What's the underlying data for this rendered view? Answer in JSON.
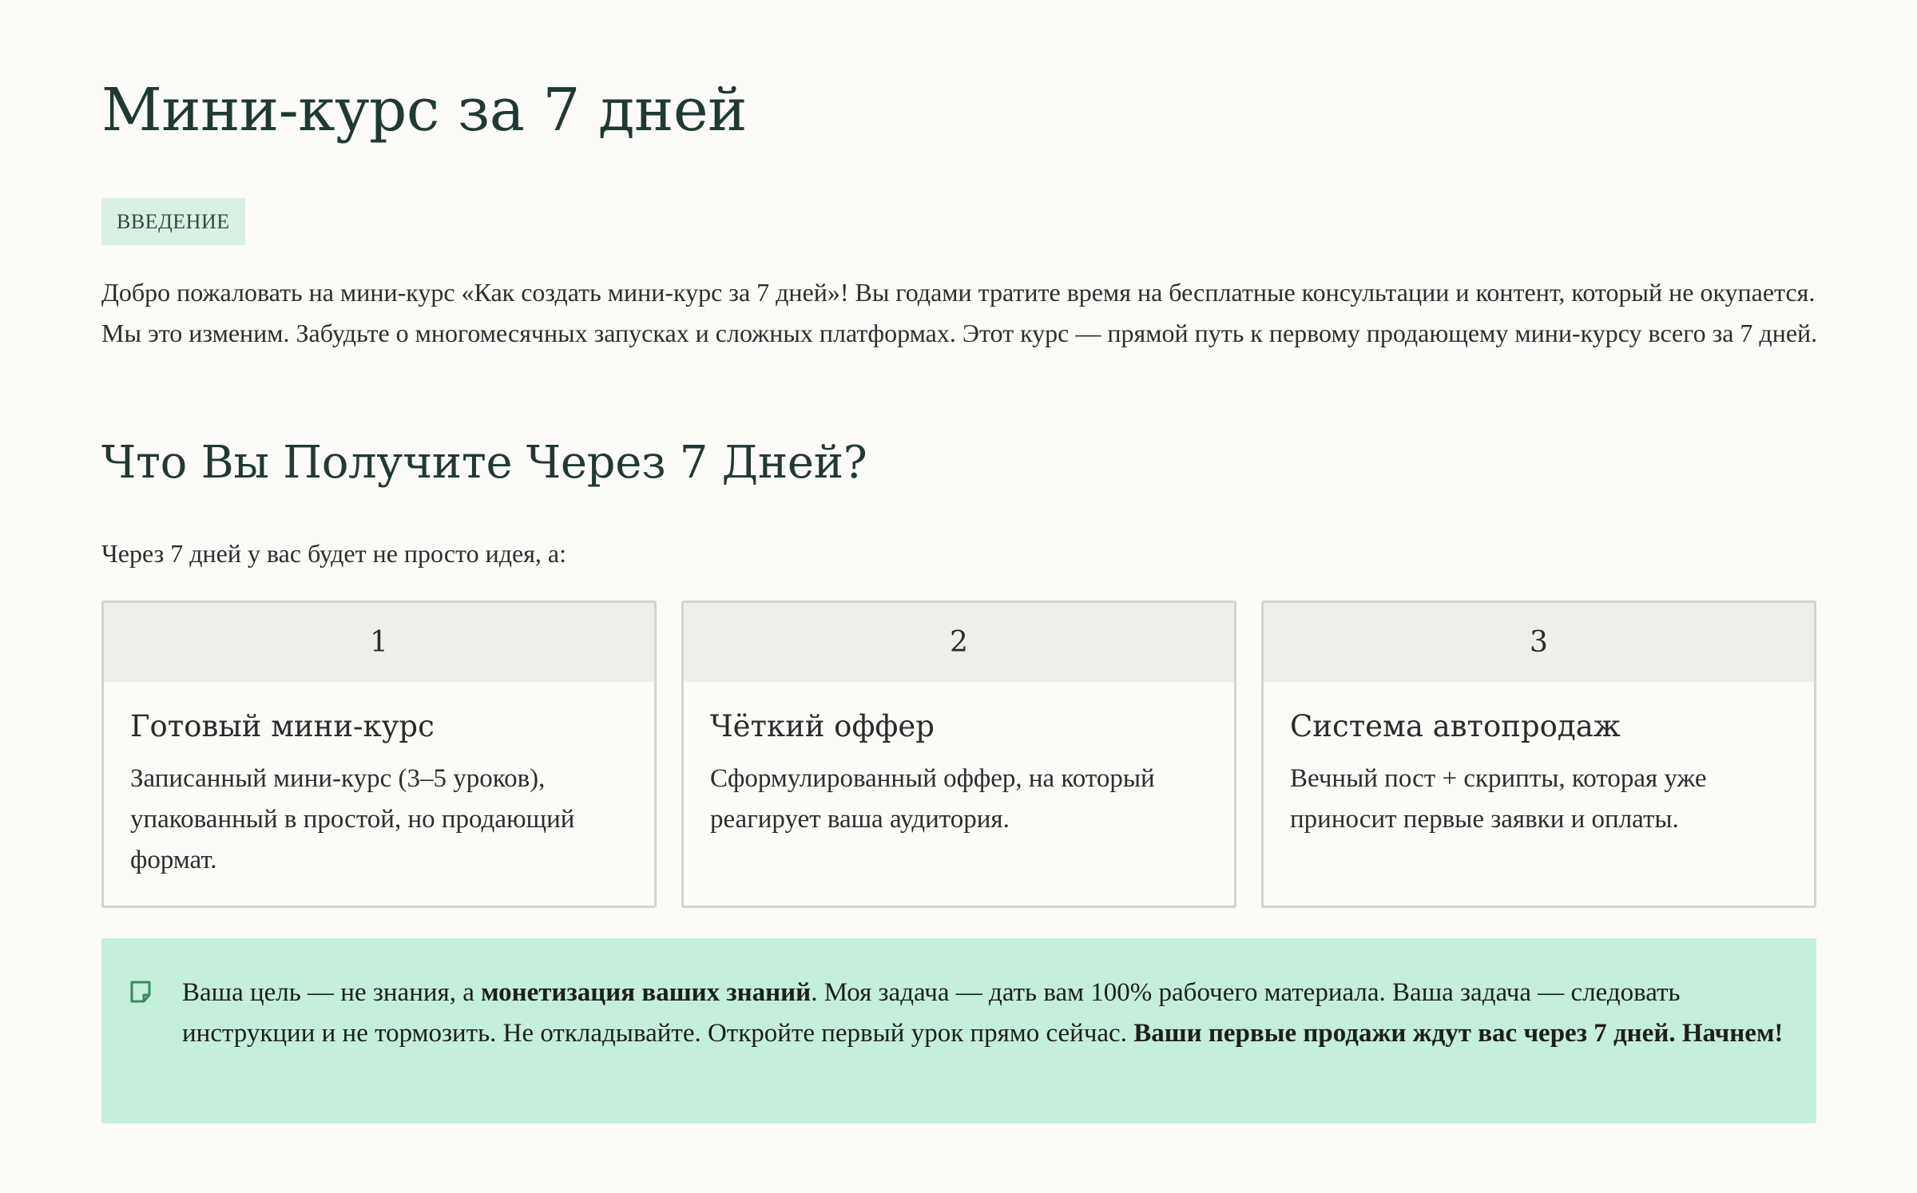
{
  "page": {
    "title": "Мини-курс за 7 дней",
    "badge": "ВВЕДЕНИЕ",
    "intro": "Добро пожаловать на мини-курс «Как создать мини-курс за 7 дней»! Вы годами тратите время на бесплатные консультации и контент, который не окупается. Мы это изменим. Забудьте о многомесячных запусках и сложных платформах. Этот курс — прямой путь к первому продающему мини-курсу всего за 7 дней."
  },
  "section": {
    "heading": "Что Вы Получите Через 7 Дней?",
    "lead": "Через 7 дней у вас будет не просто идея, а:"
  },
  "cards": [
    {
      "number": "1",
      "title": "Готовый мини-курс",
      "text": "Записанный мини-курс (3–5 уроков), упакованный в простой, но продающий формат."
    },
    {
      "number": "2",
      "title": "Чёткий оффер",
      "text": "Сформулированный оффер, на который реагирует ваша аудитория."
    },
    {
      "number": "3",
      "title": "Система автопродаж",
      "text": "Вечный пост + скрипты, которая уже приносит первые заявки и оплаты."
    }
  ],
  "callout": {
    "icon": "note-icon",
    "part1": "Ваша цель — не знания, а ",
    "bold1": "монетизация ваших знаний",
    "part2": ". Моя задача — дать вам 100% рабочего материала. Ваша задача — следовать инструкции и не тормозить. Не откладывайте. Откройте первый урок прямо сейчас. ",
    "bold2": "Ваши первые продажи ждут вас через 7 дней. Начнем!"
  },
  "colors": {
    "heading": "#1f3a33",
    "badge_bg": "#d8f1e4",
    "card_header_bg": "#f0eee9",
    "callout_bg": "#c4efda",
    "icon": "#3a8a5c"
  }
}
